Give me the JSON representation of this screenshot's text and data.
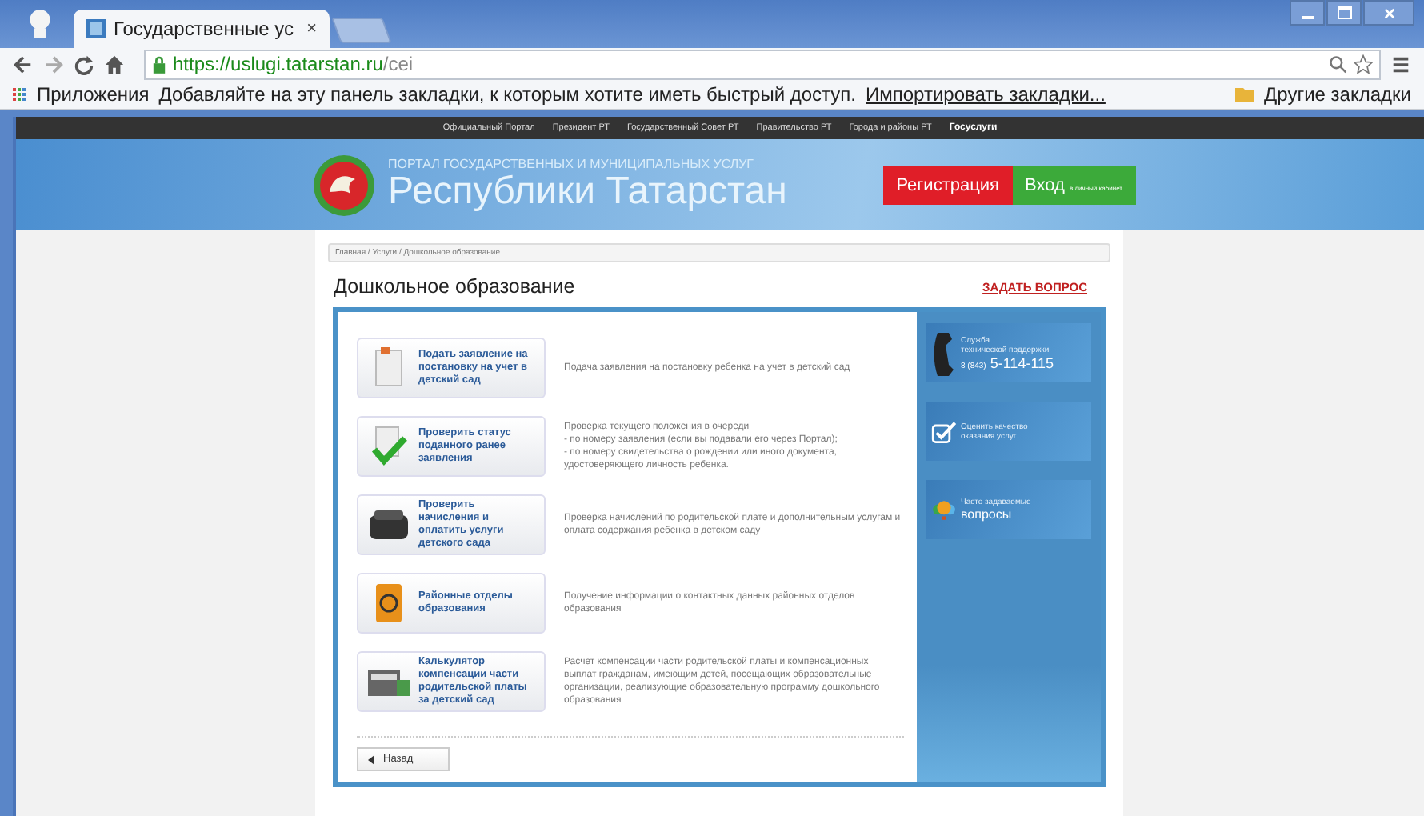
{
  "browser": {
    "tab_title": "Государственные ус",
    "tab_close": "×",
    "url_host": "https://uslugi.tatarstan.ru",
    "url_path": "/cei",
    "apps_label": "Приложения",
    "bookmarks_prompt": "Добавляйте на эту панель закладки, к которым хотите иметь быстрый доступ.",
    "import_link": "Импортировать закладки...",
    "other_bookmarks": "Другие закладки"
  },
  "site_nav": [
    {
      "label": "Официальный Портал",
      "selected": false
    },
    {
      "label": "Президент РТ",
      "selected": false
    },
    {
      "label": "Государственный Совет РТ",
      "selected": false
    },
    {
      "label": "Правительство РТ",
      "selected": false
    },
    {
      "label": "Города и районы РТ",
      "selected": false
    },
    {
      "label": "Госуслуги",
      "selected": true
    }
  ],
  "portal": {
    "subtitle": "ПОРТАЛ ГОСУДАРСТВЕННЫХ И МУНИЦИПАЛЬНЫХ УСЛУГ",
    "title": "Республики Татарстан",
    "register": "Регистрация",
    "login": "Вход",
    "login_note": "в личный кабинет"
  },
  "breadcrumb": "Главная / Услуги / Дошкольное образование",
  "page_title": "Дошкольное образование",
  "ask_link": "ЗАДАТЬ ВОПРОС",
  "services": [
    {
      "kind": "document",
      "label": "Подать заявление на постановку на учет в детский сад",
      "description": "Подача заявления на постановку ребенка на учет в детский сад"
    },
    {
      "kind": "check",
      "label": "Проверить статус поданного ранее заявления",
      "description": "Проверка текущего положения в очереди\n- по номеру заявления (если вы подавали его через Портал);\n- по номеру свидетельства о рождении или иного документа, удостоверяющего личность ребенка."
    },
    {
      "kind": "wallet",
      "label": "Проверить начисления и оплатить услуги детского сада",
      "description": "Проверка начислений по родительской плате и дополнительным услугам и оплата содержания ребенка в детском саду"
    },
    {
      "kind": "phonebook",
      "label": "Районные отделы образования",
      "description": "Получение информации о контактных данных районных отделов образования"
    },
    {
      "kind": "calculator",
      "label": "Калькулятор компенсации части родительской платы за детский сад",
      "description": "Расчет компенсации части родительской платы и компенсационных выплат гражданам, имеющим детей, посещающих образовательные организации, реализующие образовательную программу дошкольного образования"
    }
  ],
  "back_button": "Назад",
  "side_tiles": [
    {
      "kind": "support",
      "lines": [
        "Служба",
        "технической поддержки"
      ],
      "phone_prefix": "8 (843)",
      "phone": "5-114-115"
    },
    {
      "kind": "rating",
      "lines": [
        "Оценить качество",
        "оказания услуг"
      ]
    },
    {
      "kind": "faq",
      "lines": [
        "Часто задаваемые"
      ],
      "big": "вопросы"
    }
  ]
}
